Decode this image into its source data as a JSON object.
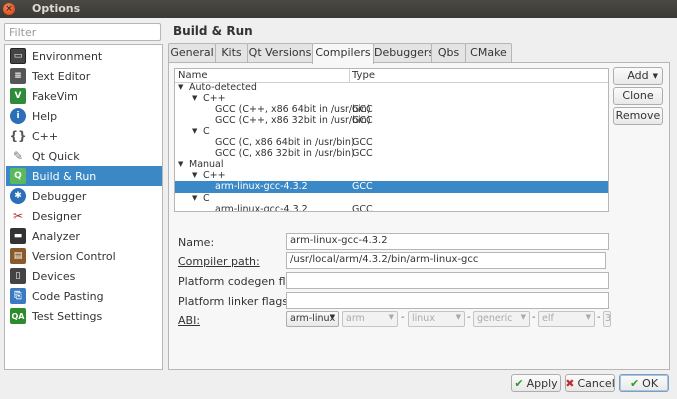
{
  "window": {
    "title": "Options"
  },
  "filter": {
    "placeholder": "Filter"
  },
  "sidebar": {
    "items": [
      {
        "label": "Environment",
        "icon": "monitor-icon"
      },
      {
        "label": "Text Editor",
        "icon": "text-editor-icon"
      },
      {
        "label": "FakeVim",
        "icon": "fakevim-icon"
      },
      {
        "label": "Help",
        "icon": "help-icon"
      },
      {
        "label": "C++",
        "icon": "cpp-icon"
      },
      {
        "label": "Qt Quick",
        "icon": "qt-quick-icon"
      },
      {
        "label": "Build & Run",
        "icon": "build-run-icon"
      },
      {
        "label": "Debugger",
        "icon": "debugger-icon"
      },
      {
        "label": "Designer",
        "icon": "designer-icon"
      },
      {
        "label": "Analyzer",
        "icon": "analyzer-icon"
      },
      {
        "label": "Version Control",
        "icon": "version-control-icon"
      },
      {
        "label": "Devices",
        "icon": "devices-icon"
      },
      {
        "label": "Code Pasting",
        "icon": "code-pasting-icon"
      },
      {
        "label": "Test Settings",
        "icon": "test-settings-icon"
      }
    ],
    "selected": "Build & Run"
  },
  "page": {
    "title": "Build & Run"
  },
  "tabs": [
    "General",
    "Kits",
    "Qt Versions",
    "Compilers",
    "Debuggers",
    "Qbs",
    "CMake"
  ],
  "active_tab": "Compilers",
  "tree": {
    "columns": [
      "Name",
      "Type"
    ],
    "rows": [
      {
        "name": "Auto-detected",
        "type": "",
        "level": 0,
        "expander": true
      },
      {
        "name": "C++",
        "type": "",
        "level": 1,
        "expander": true
      },
      {
        "name": "GCC (C++, x86 64bit in /usr/bin)",
        "type": "GCC",
        "level": 2
      },
      {
        "name": "GCC (C++, x86 32bit in /usr/bin)",
        "type": "GCC",
        "level": 2
      },
      {
        "name": "C",
        "type": "",
        "level": 1,
        "expander": true
      },
      {
        "name": "GCC (C, x86 64bit in /usr/bin)",
        "type": "GCC",
        "level": 2
      },
      {
        "name": "GCC (C, x86 32bit in /usr/bin)",
        "type": "GCC",
        "level": 2
      },
      {
        "name": "Manual",
        "type": "",
        "level": 0,
        "expander": true
      },
      {
        "name": "C++",
        "type": "",
        "level": 1,
        "expander": true
      },
      {
        "name": "arm-linux-gcc-4.3.2",
        "type": "GCC",
        "level": 2,
        "selected": true
      },
      {
        "name": "C",
        "type": "",
        "level": 1,
        "expander": true
      },
      {
        "name": "arm-linux-gcc-4.3.2",
        "type": "GCC",
        "level": 2
      }
    ]
  },
  "buttons": {
    "add": "Add",
    "clone": "Clone",
    "remove": "Remove"
  },
  "details": {
    "name_label": "Name:",
    "name_value": "arm-linux-gcc-4.3.2",
    "compiler_path_label": "Compiler path:",
    "compiler_path_value": "/usr/local/arm/4.3.2/bin/arm-linux-gcc",
    "codegen_label": "Platform codegen flags:",
    "codegen_value": "",
    "linker_label": "Platform linker flags:",
    "linker_value": "",
    "abi_label": "ABI:",
    "abi": [
      "arm-linux",
      "arm",
      "linux",
      "generic",
      "elf",
      "3"
    ]
  },
  "footer": {
    "apply": "Apply",
    "cancel": "Cancel",
    "ok": "OK"
  },
  "colors": {
    "selection": "#3a88c6",
    "titlebar": "#3f3e3a",
    "close": "#e0501c"
  }
}
